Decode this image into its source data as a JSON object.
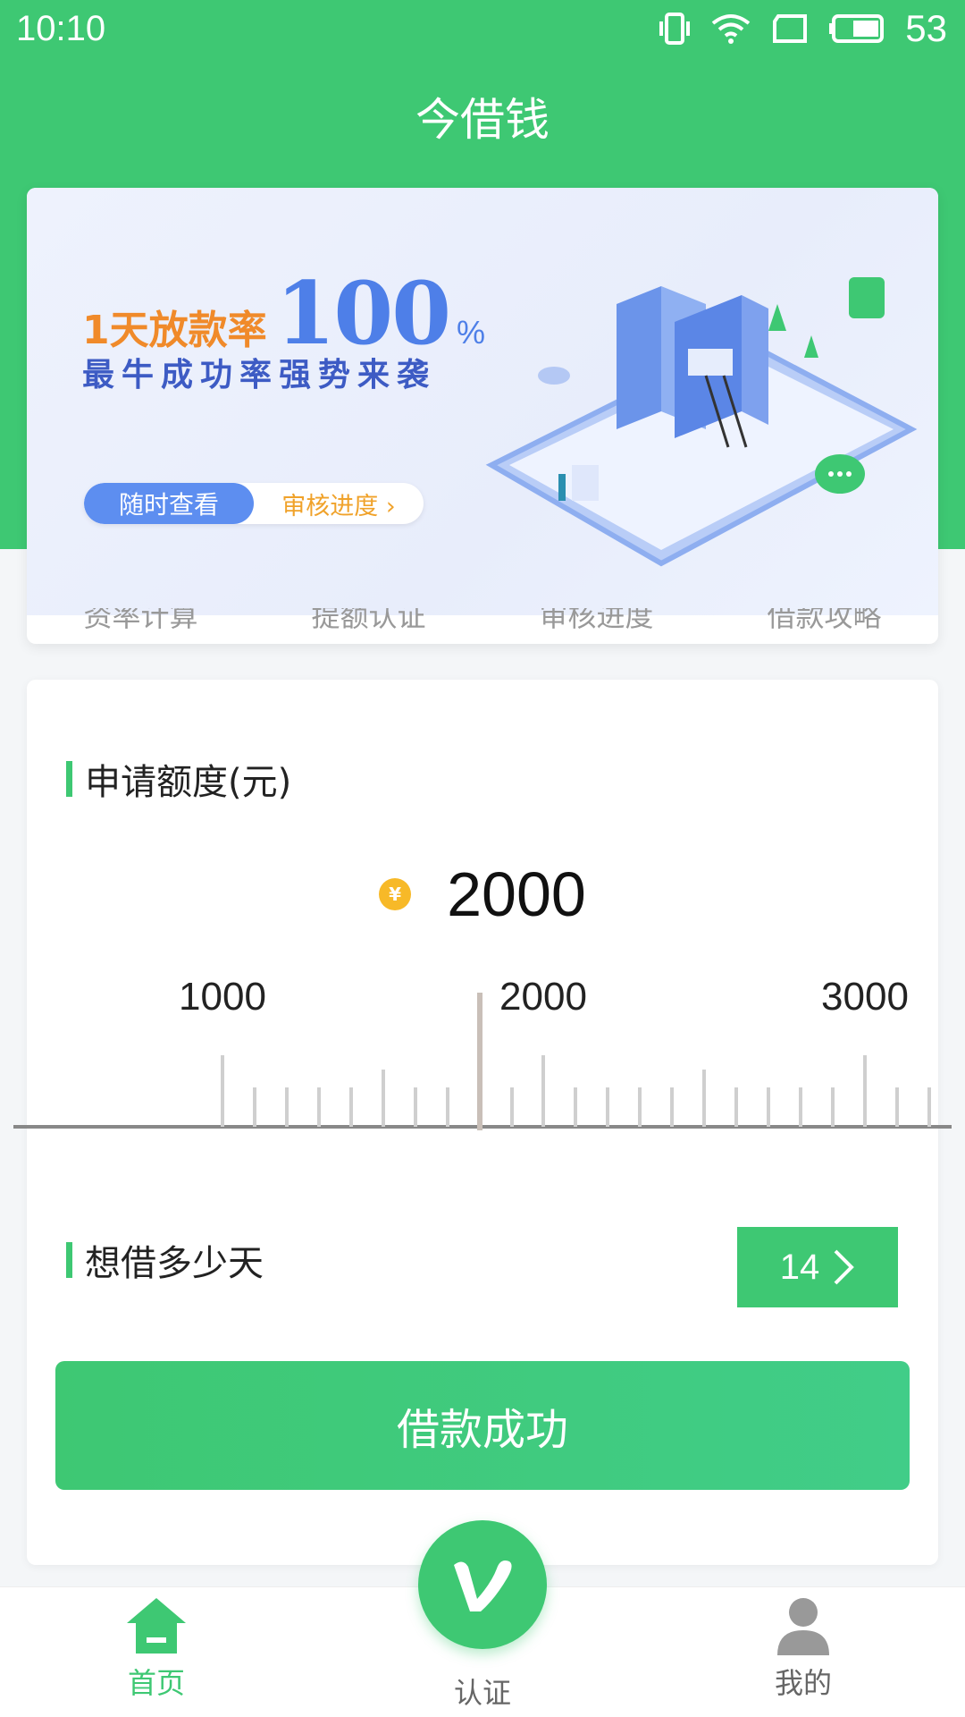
{
  "status_bar": {
    "time": "10:10",
    "battery": "53"
  },
  "app": {
    "title": "今借钱"
  },
  "banner": {
    "line1_prefix": "1天放款率",
    "line1_big": "100",
    "line1_pct": "%",
    "line2": "最牛成功率强势来袭",
    "pill_left": "随时查看",
    "pill_right": "审核进度 ›"
  },
  "menu_strip": [
    "资率计算",
    "提额认证",
    "审核进度",
    "借款攻略"
  ],
  "form": {
    "amount_title": "申请额度(元)",
    "coin_symbol": "¥",
    "amount_value": "2000",
    "ruler_labels": [
      "1000",
      "2000",
      "3000"
    ],
    "days_title": "想借多少天",
    "days_value": "14",
    "submit_label": "借款成功"
  },
  "tabs": {
    "home": "首页",
    "verify": "认证",
    "mine": "我的"
  },
  "colors": {
    "brand_green": "#3ec873",
    "accent_blue": "#4e7fe8",
    "accent_orange": "#f08a2a"
  }
}
